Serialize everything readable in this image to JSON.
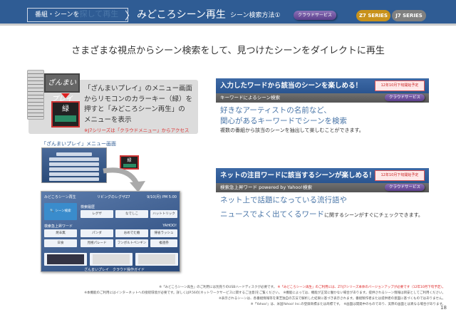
{
  "header": {
    "breadcrumb_small": "番組・シーンを",
    "breadcrumb_big": "探して再生",
    "title": "みどころシーン再生",
    "method": "シーン検索方法①",
    "cloud_badge": "クラウドサービス",
    "series": [
      "Z7 SERIES",
      "J7 SERIES"
    ]
  },
  "subtitle": "さまざまな視点からシーン検索をして、見つけたシーンをダイレクトに再生",
  "left": {
    "zanmai_logo": "ざんまいプレイ",
    "green_key": "緑",
    "desc": [
      "「ざんまいプレイ」のメニュー画面",
      "からリモコンのカラーキー（緑）を",
      "押すと「みどころシーン再生」の",
      "メニューを表示"
    ],
    "note": "※J7シリーズは「クラウドメニュー」からアクセス",
    "caption": "「ざんまいプレイ」メニュー画面"
  },
  "tv": {
    "title": "みどころシーン再生",
    "channel": "リビングのレグザZ7",
    "time": "9/10(月) PM 5:00",
    "search_btn": "シーン検索",
    "history_label": "検索履歴",
    "history": [
      "レグザ",
      "なでしこ",
      "ハットトリック"
    ],
    "rising_label": "検索急上昇ワード",
    "yahoo": "YAHOO!",
    "words": [
      "焼辛無",
      "パンダ",
      "おめでた婚",
      "帰省ラッシュ",
      "日食",
      "見極パレード",
      "フンボルトペンギン",
      "複週券"
    ],
    "footer": "ざんまいプレイ　クラウド操作ガイド"
  },
  "panel1": {
    "heading": "入力したワードから該当のシーンを楽しめる！",
    "badge": "12年10月下旬開始予定",
    "sub": "キーワードによるシーン検索",
    "cloud": "クラウドサービス",
    "big1": "好きなアーティストの名前など、",
    "big2": "関心があるキーワードでシーンを検索",
    "small": "複数の番組から該当のシーンを抽出して楽しむことができます。"
  },
  "panel2": {
    "heading": "ネットの注目ワードに該当するシーンが楽しめる！",
    "badge": "12年10月下旬開始予定",
    "sub": "検索急上昇ワード powered by Yahoo!検索",
    "cloud": "クラウドサービス",
    "big1": "ネット上で話題になっている流行語や",
    "big2": "ニュースでよく出てくるワード",
    "small": "に関するシーンがすぐにチェックできます。"
  },
  "footer": {
    "line1a": "※「みどころシーン再生」のご利用には別売りのUSBハードディスクが必要です。",
    "line1b": "※「みどころシーン再生」のご利用には、Z7/J7シリーズ本体のバージョンアップが必要です（12年10月下旬予定）。",
    "line2": "※本機能のご利用にはインターネットへの接続環境が必要です。詳しくはP.56の[ネットワークサービスに関するご注意]をご覧ください。　※機能によっては、機能が正常に働かない場合があります。提供されるシーン情報は目安としてご利用ください。",
    "line3": "※表示されるシーンは、各番組情報等を東芝独自の方法で解析した結果に基づき表示されます。番組製作者または提供者の意図に基づくものではありません。",
    "line4": "※「Yahoo!」は、米国Yahoo! Inc.の登録商標または商標です。　※画面は開発中のものであり、実際の画面とは異なる場合があります。",
    "page": "18"
  }
}
